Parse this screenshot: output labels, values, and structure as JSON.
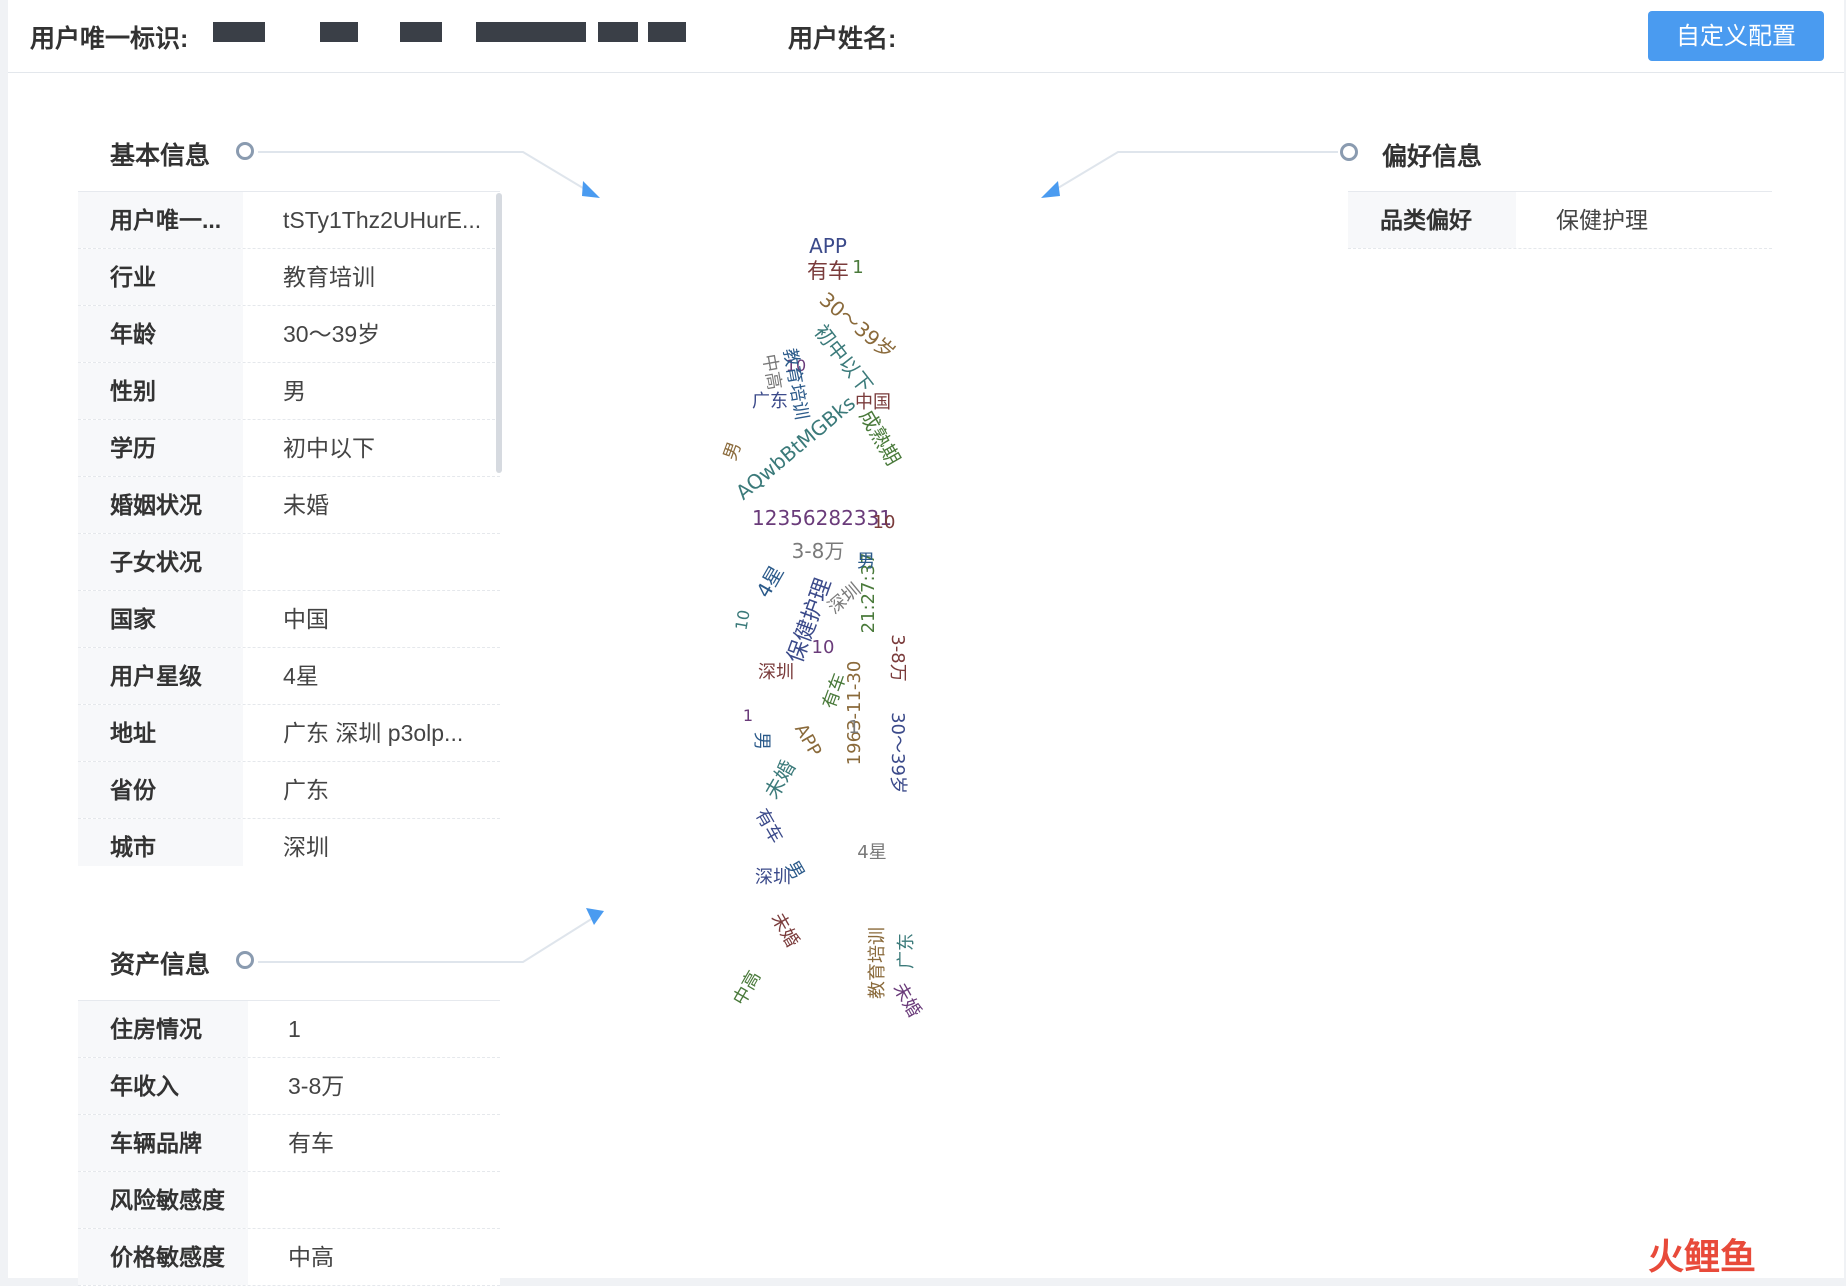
{
  "header": {
    "user_id_label": "用户唯一标识:",
    "user_name_label": "用户姓名:",
    "config_button": "自定义配置"
  },
  "basic_info": {
    "title": "基本信息",
    "rows": [
      {
        "key": "用户唯一...",
        "value": "tSTy1Thz2UHurE..."
      },
      {
        "key": "行业",
        "value": "教育培训"
      },
      {
        "key": "年龄",
        "value": "30～39岁"
      },
      {
        "key": "性别",
        "value": "男"
      },
      {
        "key": "学历",
        "value": "初中以下"
      },
      {
        "key": "婚姻状况",
        "value": "未婚"
      },
      {
        "key": "子女状况",
        "value": ""
      },
      {
        "key": "国家",
        "value": "中国"
      },
      {
        "key": "用户星级",
        "value": "4星"
      },
      {
        "key": "地址",
        "value": "广东 深圳 p3olp..."
      },
      {
        "key": "省份",
        "value": "广东"
      },
      {
        "key": "城市",
        "value": "深圳"
      }
    ]
  },
  "asset_info": {
    "title": "资产信息",
    "rows": [
      {
        "key": "住房情况",
        "value": "1"
      },
      {
        "key": "年收入",
        "value": "3-8万"
      },
      {
        "key": "车辆品牌",
        "value": "有车"
      },
      {
        "key": "风险敏感度",
        "value": ""
      },
      {
        "key": "价格敏感度",
        "value": "中高"
      }
    ]
  },
  "preference_info": {
    "title": "偏好信息",
    "rows": [
      {
        "key": "品类偏好",
        "value": "保健护理"
      }
    ]
  },
  "word_cloud": {
    "palette": [
      "#3b4a8a",
      "#7a3b3b",
      "#4a7a3b",
      "#8a6a3b",
      "#3b7a7a",
      "#6a3b7a",
      "#7a7a7a",
      "#2b5a8a"
    ],
    "words": [
      {
        "text": "APP"
      },
      {
        "text": "有车"
      },
      {
        "text": "1"
      },
      {
        "text": "30～39岁"
      },
      {
        "text": "初中以下"
      },
      {
        "text": "10"
      },
      {
        "text": "中高"
      },
      {
        "text": "教育培训"
      },
      {
        "text": "广东"
      },
      {
        "text": "中国"
      },
      {
        "text": "成熟期"
      },
      {
        "text": "男"
      },
      {
        "text": "AQwbBtMGBks"
      },
      {
        "text": "12356282331"
      },
      {
        "text": "3-8万"
      },
      {
        "text": "4星"
      },
      {
        "text": "保健护理"
      },
      {
        "text": "深圳"
      },
      {
        "text": "21:27:37"
      },
      {
        "text": "1963-11-30"
      },
      {
        "text": "未婚"
      },
      {
        "text": "10"
      },
      {
        "text": "1"
      },
      {
        "text": "男"
      },
      {
        "text": "深圳"
      },
      {
        "text": "未婚"
      },
      {
        "text": "中高"
      },
      {
        "text": "教育培训"
      },
      {
        "text": "广东"
      },
      {
        "text": "未婚"
      },
      {
        "text": "4星"
      },
      {
        "text": "男"
      },
      {
        "text": "30～39岁"
      },
      {
        "text": "3-8万"
      },
      {
        "text": "有车"
      },
      {
        "text": "APP"
      },
      {
        "text": "10"
      },
      {
        "text": "1"
      },
      {
        "text": "深圳"
      },
      {
        "text": "男"
      },
      {
        "text": "有车"
      },
      {
        "text": "10"
      }
    ]
  },
  "watermark": {
    "text": "火鲤鱼"
  }
}
